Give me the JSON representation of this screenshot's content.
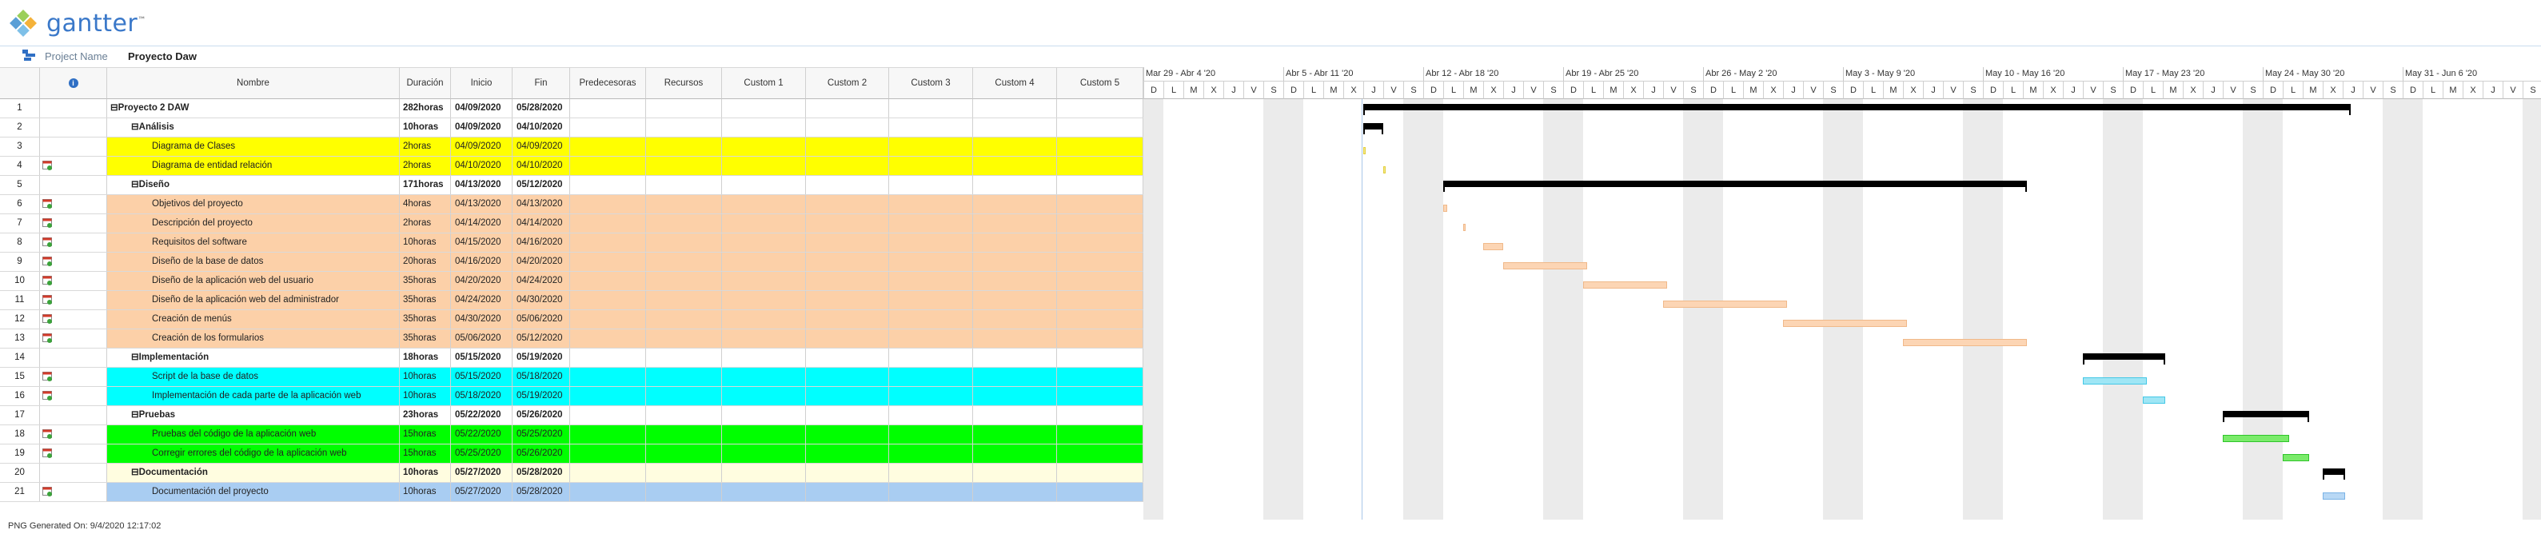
{
  "app": {
    "logo_text": "gantter",
    "logo_tm": "™"
  },
  "project": {
    "label": "Project Name",
    "name": "Proyecto Daw"
  },
  "columns": {
    "name": "Nombre",
    "duration": "Duración",
    "start": "Inicio",
    "finish": "Fin",
    "predecessors": "Predecesoras",
    "resources": "Recursos",
    "custom1": "Custom 1",
    "custom2": "Custom 2",
    "custom3": "Custom 3",
    "custom4": "Custom 4",
    "custom5": "Custom 5"
  },
  "tasks": [
    {
      "num": "1",
      "name": "⊟Proyecto 2 DAW",
      "duration": "282horas",
      "start": "04/09/2020",
      "finish": "05/28/2020",
      "level": 0,
      "summary": true,
      "color": "#ffffff",
      "cal": false
    },
    {
      "num": "2",
      "name": "⊟Análisis",
      "duration": "10horas",
      "start": "04/09/2020",
      "finish": "04/10/2020",
      "level": 1,
      "summary": true,
      "color": "#ffffff",
      "cal": false
    },
    {
      "num": "3",
      "name": "Diagrama de Clases",
      "duration": "2horas",
      "start": "04/09/2020",
      "finish": "04/09/2020",
      "level": 2,
      "summary": false,
      "color": "#ffff00",
      "cal": false
    },
    {
      "num": "4",
      "name": "Diagrama de entidad relación",
      "duration": "2horas",
      "start": "04/10/2020",
      "finish": "04/10/2020",
      "level": 2,
      "summary": false,
      "color": "#ffff00",
      "cal": true
    },
    {
      "num": "5",
      "name": "⊟Diseño",
      "duration": "171horas",
      "start": "04/13/2020",
      "finish": "05/12/2020",
      "level": 1,
      "summary": true,
      "color": "#ffffff",
      "cal": false
    },
    {
      "num": "6",
      "name": "Objetivos del proyecto",
      "duration": "4horas",
      "start": "04/13/2020",
      "finish": "04/13/2020",
      "level": 2,
      "summary": false,
      "color": "#fcd0a8",
      "cal": true
    },
    {
      "num": "7",
      "name": "Descripción del proyecto",
      "duration": "2horas",
      "start": "04/14/2020",
      "finish": "04/14/2020",
      "level": 2,
      "summary": false,
      "color": "#fcd0a8",
      "cal": true
    },
    {
      "num": "8",
      "name": "Requisitos del software",
      "duration": "10horas",
      "start": "04/15/2020",
      "finish": "04/16/2020",
      "level": 2,
      "summary": false,
      "color": "#fcd0a8",
      "cal": true
    },
    {
      "num": "9",
      "name": "Diseño de la base de datos",
      "duration": "20horas",
      "start": "04/16/2020",
      "finish": "04/20/2020",
      "level": 2,
      "summary": false,
      "color": "#fcd0a8",
      "cal": true
    },
    {
      "num": "10",
      "name": "Diseño de la aplicación web del usuario",
      "duration": "35horas",
      "start": "04/20/2020",
      "finish": "04/24/2020",
      "level": 2,
      "summary": false,
      "color": "#fcd0a8",
      "cal": true
    },
    {
      "num": "11",
      "name": "Diseño de la aplicación web del administrador",
      "duration": "35horas",
      "start": "04/24/2020",
      "finish": "04/30/2020",
      "level": 2,
      "summary": false,
      "color": "#fcd0a8",
      "cal": true
    },
    {
      "num": "12",
      "name": "Creación de menús",
      "duration": "35horas",
      "start": "04/30/2020",
      "finish": "05/06/2020",
      "level": 2,
      "summary": false,
      "color": "#fcd0a8",
      "cal": true
    },
    {
      "num": "13",
      "name": "Creación de los formularios",
      "duration": "35horas",
      "start": "05/06/2020",
      "finish": "05/12/2020",
      "level": 2,
      "summary": false,
      "color": "#fcd0a8",
      "cal": true
    },
    {
      "num": "14",
      "name": "⊟Implementación",
      "duration": "18horas",
      "start": "05/15/2020",
      "finish": "05/19/2020",
      "level": 1,
      "summary": true,
      "color": "#ffffff",
      "cal": false
    },
    {
      "num": "15",
      "name": "Script de la base de datos",
      "duration": "10horas",
      "start": "05/15/2020",
      "finish": "05/18/2020",
      "level": 2,
      "summary": false,
      "color": "#00ffff",
      "cal": true
    },
    {
      "num": "16",
      "name": "Implementación de cada parte de la aplicación web",
      "duration": "10horas",
      "start": "05/18/2020",
      "finish": "05/19/2020",
      "level": 2,
      "summary": false,
      "color": "#00ffff",
      "cal": true
    },
    {
      "num": "17",
      "name": "⊟Pruebas",
      "duration": "23horas",
      "start": "05/22/2020",
      "finish": "05/26/2020",
      "level": 1,
      "summary": true,
      "color": "#ffffff",
      "cal": false
    },
    {
      "num": "18",
      "name": "Pruebas del código de la aplicación web",
      "duration": "15horas",
      "start": "05/22/2020",
      "finish": "05/25/2020",
      "level": 2,
      "summary": false,
      "color": "#00ff00",
      "cal": true
    },
    {
      "num": "19",
      "name": "Corregir errores del código de la aplicación web",
      "duration": "15horas",
      "start": "05/25/2020",
      "finish": "05/26/2020",
      "level": 2,
      "summary": false,
      "color": "#00ff00",
      "cal": true
    },
    {
      "num": "20",
      "name": "⊟Documentación",
      "duration": "10horas",
      "start": "05/27/2020",
      "finish": "05/28/2020",
      "level": 1,
      "summary": true,
      "color": "#fffde0",
      "cal": false
    },
    {
      "num": "21",
      "name": "Documentación del proyecto",
      "duration": "10horas",
      "start": "05/27/2020",
      "finish": "05/28/2020",
      "level": 2,
      "summary": false,
      "color": "#a9cdf2",
      "cal": true
    }
  ],
  "timeline": {
    "start_date": "2020-03-29",
    "day_count": 70,
    "weeks": [
      "Mar 29 - Abr 4 '20",
      "Abr 5 - Abr 11 '20",
      "Abr 12 - Abr 18 '20",
      "Abr 19 - Abr 25 '20",
      "Abr 26 - May 2 '20",
      "May 3 - May 9 '20",
      "May 10 - May 16 '20",
      "May 17 - May 23 '20",
      "May 24 - May 30 '20",
      "May 31 - Jun 6 '20"
    ],
    "day_letters": [
      "D",
      "L",
      "M",
      "X",
      "J",
      "V",
      "S"
    ]
  },
  "bars": [
    {
      "row": 1,
      "type": "summary",
      "start": 11,
      "end": 60.4
    },
    {
      "row": 2,
      "type": "summary",
      "start": 11,
      "end": 12.0
    },
    {
      "row": 3,
      "type": "task",
      "start": 11,
      "end": 11.1,
      "fill": "#f5e98a",
      "border": "#e3d040"
    },
    {
      "row": 4,
      "type": "task",
      "start": 12,
      "end": 12.1,
      "fill": "#f5e98a",
      "border": "#e3d040"
    },
    {
      "row": 5,
      "type": "summary",
      "start": 15,
      "end": 44.2
    },
    {
      "row": 6,
      "type": "task",
      "start": 15,
      "end": 15.2,
      "fill": "#fcd5b4",
      "border": "#f0b98a"
    },
    {
      "row": 7,
      "type": "task",
      "start": 16,
      "end": 16.1,
      "fill": "#fcd5b4",
      "border": "#f0b98a"
    },
    {
      "row": 8,
      "type": "task",
      "start": 17,
      "end": 18.0,
      "fill": "#fcd5b4",
      "border": "#f0b98a"
    },
    {
      "row": 9,
      "type": "task",
      "start": 18,
      "end": 22.2,
      "fill": "#fcd5b4",
      "border": "#f0b98a"
    },
    {
      "row": 10,
      "type": "task",
      "start": 22,
      "end": 26.2,
      "fill": "#fcd5b4",
      "border": "#f0b98a"
    },
    {
      "row": 11,
      "type": "task",
      "start": 26,
      "end": 32.2,
      "fill": "#fcd5b4",
      "border": "#f0b98a"
    },
    {
      "row": 12,
      "type": "task",
      "start": 32,
      "end": 38.2,
      "fill": "#fcd5b4",
      "border": "#f0b98a"
    },
    {
      "row": 13,
      "type": "task",
      "start": 38,
      "end": 44.2,
      "fill": "#fcd5b4",
      "border": "#f0b98a"
    },
    {
      "row": 14,
      "type": "summary",
      "start": 47,
      "end": 51.1
    },
    {
      "row": 15,
      "type": "task",
      "start": 47,
      "end": 50.2,
      "fill": "#9fe6f5",
      "border": "#45c8e6"
    },
    {
      "row": 16,
      "type": "task",
      "start": 50,
      "end": 51.1,
      "fill": "#9fe6f5",
      "border": "#45c8e6"
    },
    {
      "row": 17,
      "type": "summary",
      "start": 54,
      "end": 58.3
    },
    {
      "row": 18,
      "type": "task",
      "start": 54,
      "end": 57.3,
      "fill": "#7aeb6a",
      "border": "#2fc42a"
    },
    {
      "row": 19,
      "type": "task",
      "start": 57,
      "end": 58.3,
      "fill": "#7aeb6a",
      "border": "#2fc42a"
    },
    {
      "row": 20,
      "type": "summary",
      "start": 59,
      "end": 60.1
    },
    {
      "row": 21,
      "type": "task",
      "start": 59,
      "end": 60.1,
      "fill": "#b8d8f5",
      "border": "#7ab3e6"
    }
  ],
  "footer": "PNG Generated On: 9/4/2020 12:17:02"
}
